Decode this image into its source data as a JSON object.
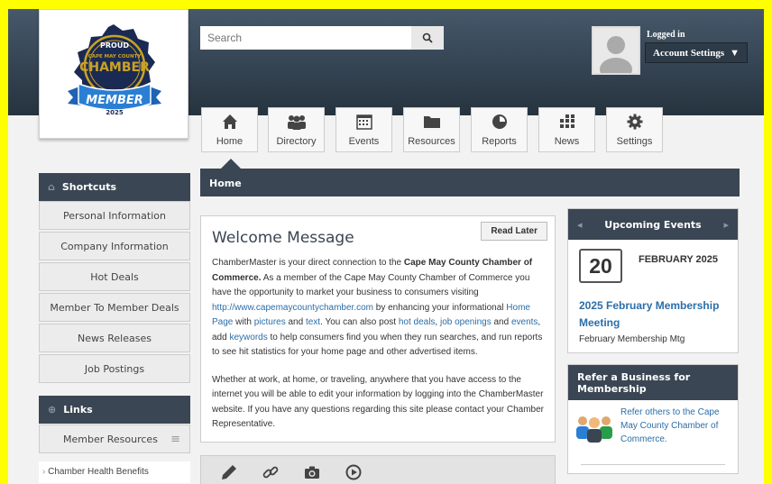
{
  "logo": {
    "top_text": "PROUD",
    "org_text": "CAPE MAY COUNTY",
    "main_text": "CHAMBER",
    "ribbon_text": "MEMBER",
    "year": "2025"
  },
  "search": {
    "placeholder": "Search"
  },
  "user": {
    "logged_in_label": "Logged in",
    "account_settings_label": "Account Settings"
  },
  "nav": {
    "items": [
      {
        "label": "Home",
        "icon": "home-icon"
      },
      {
        "label": "Directory",
        "icon": "users-icon"
      },
      {
        "label": "Events",
        "icon": "calendar-icon"
      },
      {
        "label": "Resources",
        "icon": "folder-icon"
      },
      {
        "label": "Reports",
        "icon": "pie-chart-icon"
      },
      {
        "label": "News",
        "icon": "news-icon"
      },
      {
        "label": "Settings",
        "icon": "gear-icon"
      }
    ]
  },
  "page": {
    "title": "Home"
  },
  "shortcuts": {
    "title": "Shortcuts",
    "items": [
      "Personal Information",
      "Company Information",
      "Hot Deals",
      "Member To Member Deals",
      "News Releases",
      "Job Postings"
    ]
  },
  "links": {
    "title": "Links",
    "items": [
      "Member Resources"
    ],
    "sub_items": [
      "Chamber Health Benefits"
    ]
  },
  "welcome": {
    "title": "Welcome Message",
    "read_later": "Read Later",
    "p1_a": "ChamberMaster is your direct connection to the ",
    "p1_b": "Cape May County Chamber of Commerce.",
    "p1_c": " As a member of the Cape May County Chamber of Commerce you have the opportunity to market your business to consumers visiting ",
    "p1_link_url": "http://www.capemaycountychamber.com",
    "p1_d": " by enhancing your informational ",
    "p1_link_home": "Home Page",
    "p1_e": " with ",
    "p1_link_pictures": "pictures",
    "p1_f": " and ",
    "p1_link_text": "text",
    "p1_g": ". You can also post ",
    "p1_link_hotdeals": "hot deals",
    "p1_h": ", ",
    "p1_link_jobs": "job openings",
    "p1_i": " and ",
    "p1_link_events": "events",
    "p1_j": ", add ",
    "p1_link_keywords": "keywords",
    "p1_k": " to help consumers find you when they run searches, and run reports to see hit statistics for your home page and other advertised items.",
    "p2": "Whether at work, at home, or traveling, anywhere that you have access to the internet you will be able to edit your information by logging into the ChamberMaster website. If you have any questions regarding this site please contact your Chamber Representative."
  },
  "tools": {
    "icons": [
      "pencil-icon",
      "link-icon",
      "camera-icon",
      "play-icon"
    ]
  },
  "events": {
    "title": "Upcoming Events",
    "day": "20",
    "month": "FEBRUARY 2025",
    "event_title": "2025 February Membership Meeting",
    "event_desc": "February Membership Mtg"
  },
  "refer": {
    "title": "Refer a Business for Membership",
    "text": "Refer others to the Cape May County Chamber of Commerce."
  }
}
